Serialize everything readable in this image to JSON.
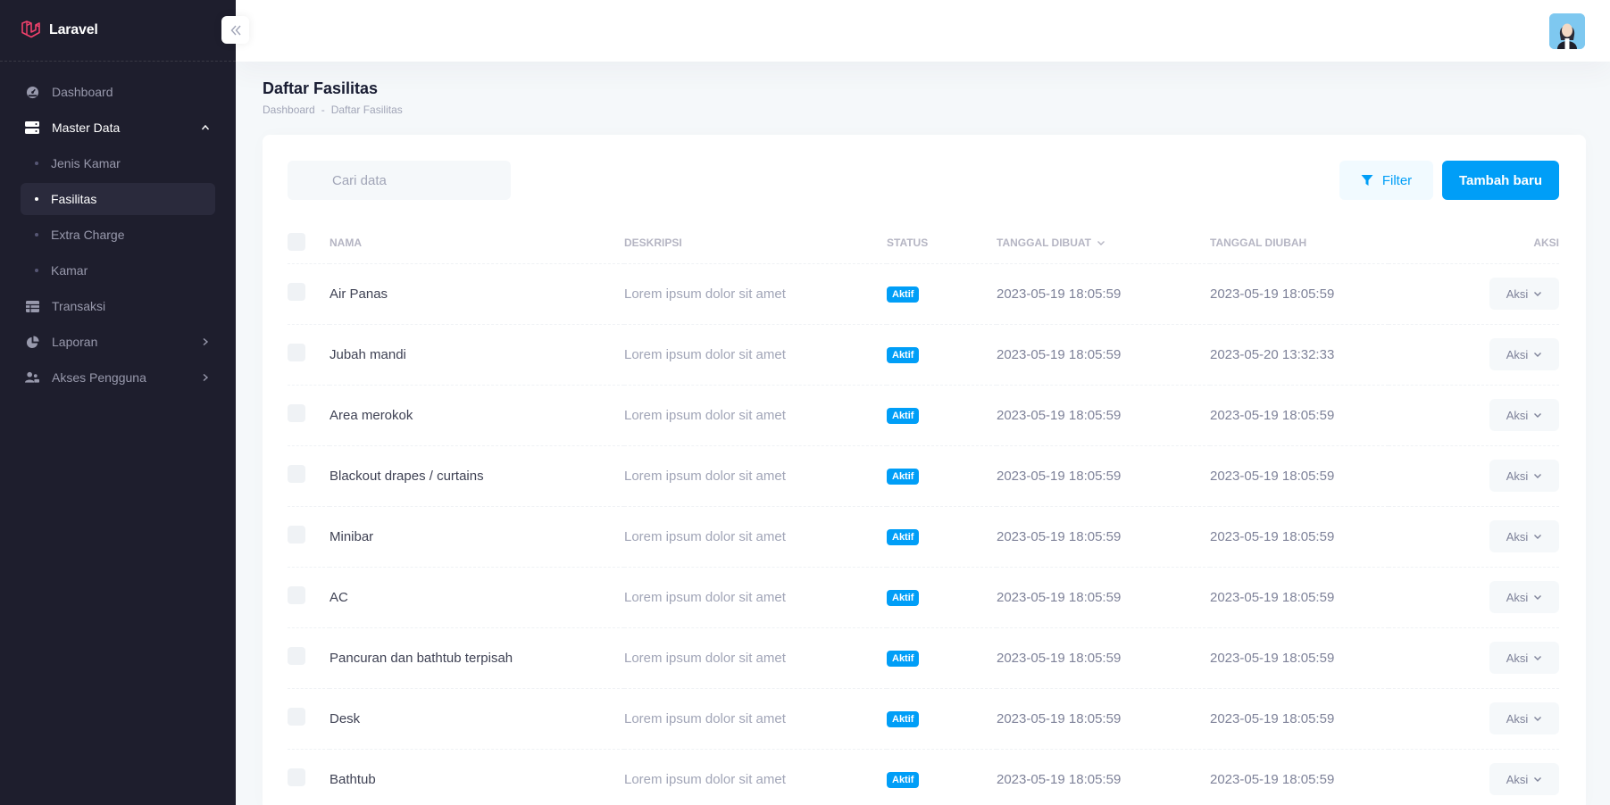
{
  "brand": {
    "name": "Laravel"
  },
  "sidebar": {
    "items": [
      {
        "label": "Dashboard",
        "icon": "dashboard-icon"
      },
      {
        "label": "Master Data",
        "icon": "database-icon",
        "open": true,
        "children": [
          {
            "label": "Jenis Kamar"
          },
          {
            "label": "Fasilitas",
            "active": true
          },
          {
            "label": "Extra Charge"
          },
          {
            "label": "Kamar"
          }
        ]
      },
      {
        "label": "Transaksi",
        "icon": "table-icon"
      },
      {
        "label": "Laporan",
        "icon": "pie-chart-icon"
      },
      {
        "label": "Akses Pengguna",
        "icon": "users-icon"
      }
    ]
  },
  "page": {
    "title": "Daftar Fasilitas",
    "breadcrumb": [
      "Dashboard",
      "Daftar Fasilitas"
    ]
  },
  "search": {
    "placeholder": "Cari data"
  },
  "actions": {
    "filter_label": "Filter",
    "add_label": "Tambah baru"
  },
  "table": {
    "headers": {
      "name": "Nama",
      "description": "Deskripsi",
      "status": "Status",
      "created": "Tanggal Dibuat",
      "updated": "Tanggal Diubah",
      "action": "Aksi"
    },
    "rows": [
      {
        "name": "Air Panas",
        "description": "Lorem ipsum dolor sit amet",
        "status": "Aktif",
        "created": "2023-05-19 18:05:59",
        "updated": "2023-05-19 18:05:59",
        "action": "Aksi"
      },
      {
        "name": "Jubah mandi",
        "description": "Lorem ipsum dolor sit amet",
        "status": "Aktif",
        "created": "2023-05-19 18:05:59",
        "updated": "2023-05-20 13:32:33",
        "action": "Aksi"
      },
      {
        "name": "Area merokok",
        "description": "Lorem ipsum dolor sit amet",
        "status": "Aktif",
        "created": "2023-05-19 18:05:59",
        "updated": "2023-05-19 18:05:59",
        "action": "Aksi"
      },
      {
        "name": "Blackout drapes / curtains",
        "description": "Lorem ipsum dolor sit amet",
        "status": "Aktif",
        "created": "2023-05-19 18:05:59",
        "updated": "2023-05-19 18:05:59",
        "action": "Aksi"
      },
      {
        "name": "Minibar",
        "description": "Lorem ipsum dolor sit amet",
        "status": "Aktif",
        "created": "2023-05-19 18:05:59",
        "updated": "2023-05-19 18:05:59",
        "action": "Aksi"
      },
      {
        "name": "AC",
        "description": "Lorem ipsum dolor sit amet",
        "status": "Aktif",
        "created": "2023-05-19 18:05:59",
        "updated": "2023-05-19 18:05:59",
        "action": "Aksi"
      },
      {
        "name": "Pancuran dan bathtub terpisah",
        "description": "Lorem ipsum dolor sit amet",
        "status": "Aktif",
        "created": "2023-05-19 18:05:59",
        "updated": "2023-05-19 18:05:59",
        "action": "Aksi"
      },
      {
        "name": "Desk",
        "description": "Lorem ipsum dolor sit amet",
        "status": "Aktif",
        "created": "2023-05-19 18:05:59",
        "updated": "2023-05-19 18:05:59",
        "action": "Aksi"
      },
      {
        "name": "Bathtub",
        "description": "Lorem ipsum dolor sit amet",
        "status": "Aktif",
        "created": "2023-05-19 18:05:59",
        "updated": "2023-05-19 18:05:59",
        "action": "Aksi"
      }
    ]
  },
  "colors": {
    "sidebar_bg": "#1e1e2d",
    "primary": "#009ef7",
    "brand_red": "#f1416c"
  }
}
